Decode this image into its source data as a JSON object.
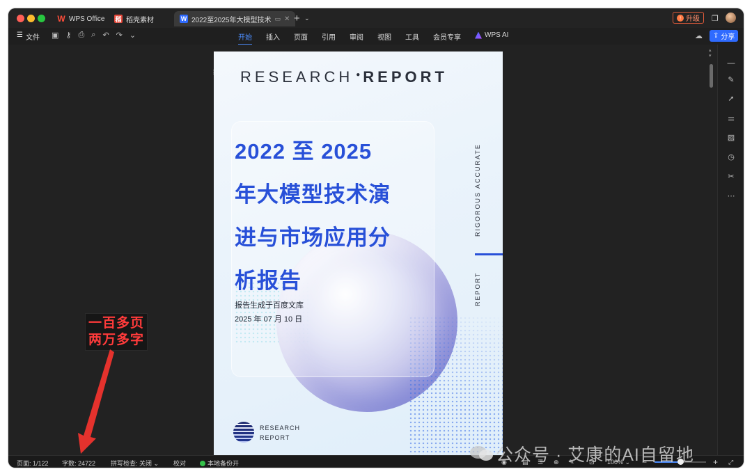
{
  "titlebar": {
    "tabs": [
      {
        "label": "WPS Office",
        "icon": "wps-logo-icon"
      },
      {
        "label": "稻壳素材",
        "icon": "docer-icon"
      },
      {
        "label": "2022至2025年大模型技术",
        "icon": "word-doc-icon"
      }
    ],
    "new_tab": "+",
    "upgrade_label": "升级"
  },
  "toolbar": {
    "file_label": "文件",
    "ribbon_tabs": [
      "开始",
      "插入",
      "页面",
      "引用",
      "审阅",
      "视图",
      "工具",
      "会员专享"
    ],
    "ai_label": "WPS AI",
    "share_label": "分享"
  },
  "document": {
    "header_left": "RESEARCH",
    "header_right": "REPORT",
    "title_lines": [
      "2022 至 2025",
      "年大模型技术演",
      "进与市场应用分",
      "析报告"
    ],
    "generated_by": "报告生成于百度文库",
    "date": "2025 年 07 月 10 日",
    "vertical_top": "RIGOROUS  ACCURATE",
    "vertical_bottom": "REPORT",
    "footer_line1": "RESEARCH",
    "footer_line2": "REPORT"
  },
  "annotation": {
    "line1": "一百多页",
    "line2": "两万多字",
    "color": "#ff3b3b"
  },
  "statusbar": {
    "page": "页面: 1/122",
    "word_count": "字数: 24722",
    "spellcheck": "拼写检查: 关闭",
    "proofread": "校对",
    "backup": "本地备份开",
    "zoom": "100%",
    "zoom_minus": "−",
    "zoom_plus": "+"
  },
  "watermark": "公众号 · 艾康的AI自留地",
  "colors": {
    "accent": "#2f6bff",
    "title_blue": "#2850d8",
    "active_tab": "#4c8dff"
  }
}
